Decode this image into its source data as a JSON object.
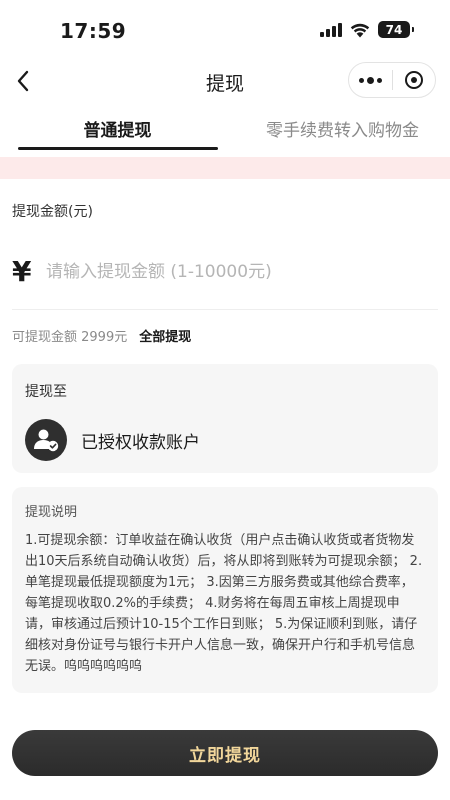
{
  "status_bar": {
    "time": "17:59",
    "battery": "74"
  },
  "nav": {
    "title": "提现"
  },
  "tabs": [
    {
      "label": "普通提现",
      "active": true
    },
    {
      "label": "零手续费转入购物金",
      "active": false
    }
  ],
  "amount": {
    "label": "提现金额(元)",
    "currency_symbol": "¥",
    "placeholder": "请输入提现金额 (1-10000元)",
    "available_text": "可提现金额 2999元",
    "withdraw_all": "全部提现"
  },
  "destination": {
    "title": "提现至",
    "account_label": "已授权收款账户"
  },
  "info": {
    "title": "提现说明",
    "body": "1.可提现余额：订单收益在确认收货（用户点击确认收货或者货物发出10天后系统自动确认收货）后，将从即将到账转为可提现余额； 2.单笔提现最低提现额度为1元； 3.因第三方服务费或其他综合费率，每笔提现收取0.2%的手续费； 4.财务将在每周五审核上周提现申请，审核通过后预计10-15个工作日到账； 5.为保证顺利到账，请仔细核对身份证号与银行卡开户人信息一致，确保开户行和手机号信息无误。呜呜呜呜呜呜"
  },
  "submit": {
    "label": "立即提现"
  },
  "colors": {
    "accent_gold": "#f2d79b",
    "button_dark": "#2f2f2f",
    "notice_pink": "#fdeaea",
    "card_gray": "#f6f6f6"
  }
}
